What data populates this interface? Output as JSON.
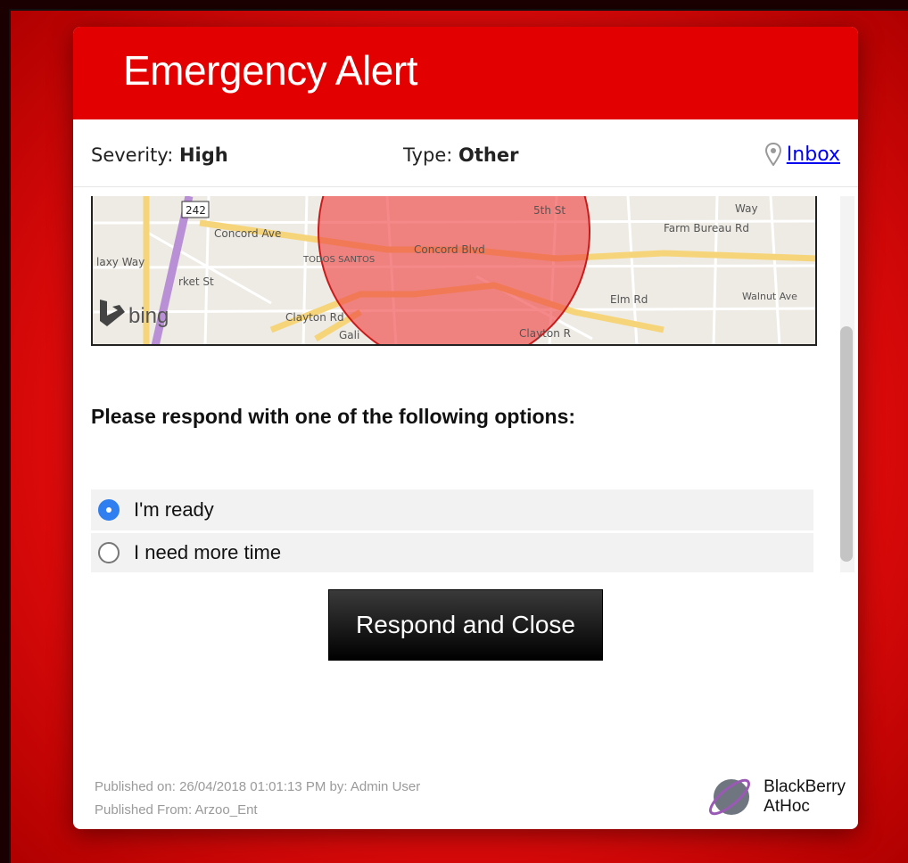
{
  "header": {
    "title": "Emergency Alert"
  },
  "info": {
    "severity_label": "Severity:",
    "severity_value": "High",
    "type_label": "Type:",
    "type_value": "Other",
    "inbox_link": "Inbox"
  },
  "map": {
    "provider": "bing",
    "labels": {
      "route": "242",
      "concord_ave": "Concord Ave",
      "todos_santos": "TODOS SANTOS",
      "concord_blvd": "Concord Blvd",
      "galaxy_way": "laxy Way",
      "market_st": "rket St",
      "clayton_rd_1": "Clayton Rd",
      "clayton_rd_2": "Clayton R",
      "elm_rd": "Elm Rd",
      "farm_bureau_rd": "Farm Bureau Rd",
      "walnut_ave": "Walnut Ave",
      "fifth_st": "5th St",
      "way": "Way",
      "gal": "Gali"
    },
    "alert_circle_color": "#ef4040"
  },
  "response": {
    "prompt": "Please respond with one of the following options:",
    "options": [
      {
        "label": "I'm ready",
        "selected": true
      },
      {
        "label": "I need more time",
        "selected": false
      }
    ],
    "submit_label": "Respond and Close"
  },
  "footer": {
    "published_on": "Published on: 26/04/2018 01:01:13 PM  by: Admin User",
    "published_from": "Published From: Arzoo_Ent",
    "brand_line1": "BlackBerry",
    "brand_line2": "AtHoc"
  },
  "colors": {
    "header_bg": "#e20000",
    "page_bg": "#e80d0d",
    "radio_selected": "#2f7ff0",
    "link": "#0000ee"
  }
}
